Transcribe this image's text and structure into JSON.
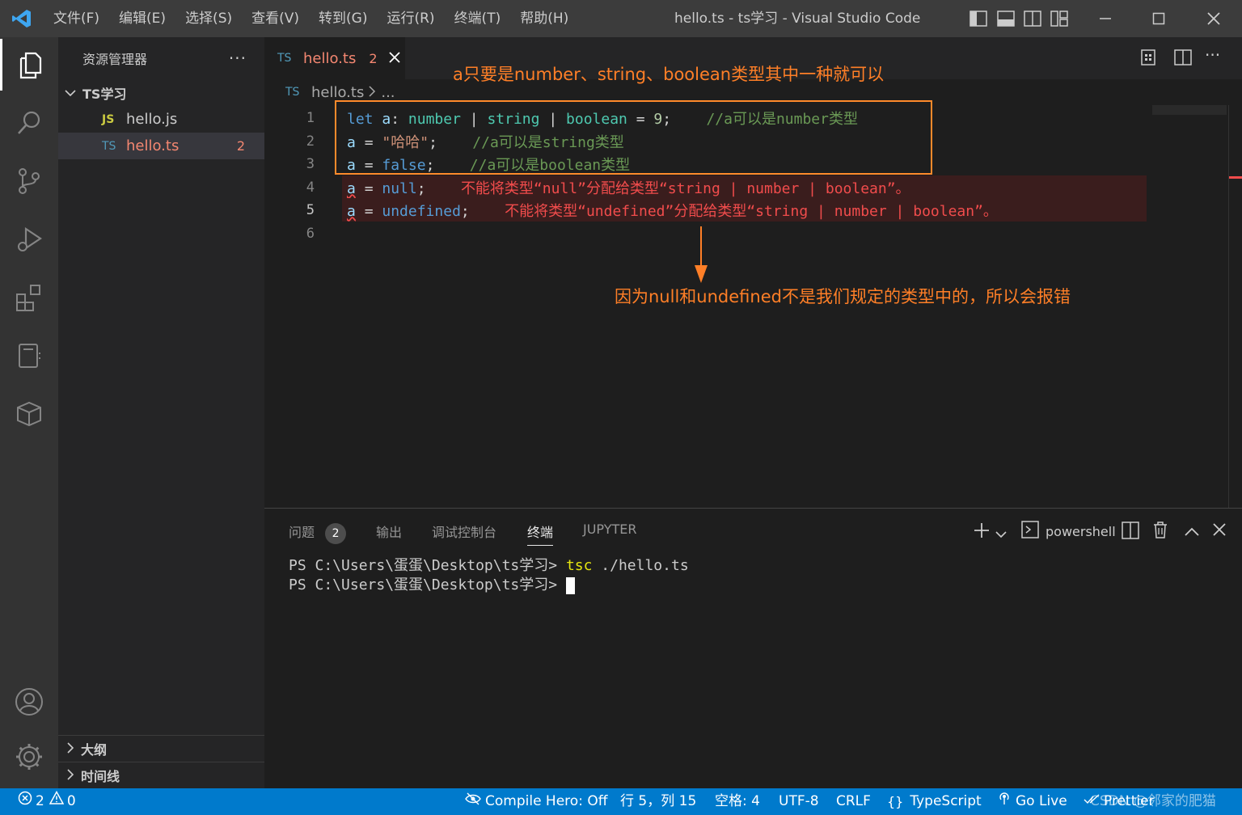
{
  "titlebar": {
    "menus": [
      "文件(F)",
      "编辑(E)",
      "选择(S)",
      "查看(V)",
      "转到(G)",
      "运行(R)",
      "终端(T)",
      "帮助(H)"
    ],
    "window_title": "hello.ts - ts学习 - Visual Studio Code"
  },
  "sidebar": {
    "title": "资源管理器",
    "folder": "TS学习",
    "files": [
      {
        "badge": "JS",
        "name": "hello.js",
        "problems": ""
      },
      {
        "badge": "TS",
        "name": "hello.ts",
        "problems": "2"
      }
    ],
    "outline": "大纲",
    "timeline": "时间线"
  },
  "tab": {
    "badge": "TS",
    "name": "hello.ts",
    "problems": "2"
  },
  "breadcrumb": {
    "badge": "TS",
    "file": "hello.ts",
    "rest": "..."
  },
  "editor": {
    "line_numbers": [
      "1",
      "2",
      "3",
      "4",
      "5",
      "6"
    ],
    "line1": {
      "kw": "let",
      "var": "a",
      "colon": ":",
      "t1": "number",
      "bar": "|",
      "t2": "string",
      "t3": "boolean",
      "eq": "=",
      "num": "9",
      "semi": ";",
      "comment": "//a可以是number类型"
    },
    "line2": {
      "var": "a",
      "eq": "=",
      "str": "\"哈哈\"",
      "semi": ";",
      "comment": "//a可以是string类型"
    },
    "line3": {
      "var": "a",
      "eq": "=",
      "val": "false",
      "semi": ";",
      "comment": "//a可以是boolean类型"
    },
    "line4": {
      "var": "a",
      "eq": "=",
      "val": "null",
      "semi": ";",
      "error": "不能将类型“null”分配给类型“string | number | boolean”。"
    },
    "line5": {
      "var": "a",
      "eq": "=",
      "val": "undefined",
      "semi": ";",
      "error": "不能将类型“undefined”分配给类型“string | number | boolean”。"
    }
  },
  "annotations": {
    "top": "a只要是number、string、boolean类型其中一种就可以",
    "bottom": "因为null和undefined不是我们规定的类型中的，所以会报错"
  },
  "panel": {
    "tabs": [
      "问题",
      "输出",
      "调试控制台",
      "终端",
      "JUPYTER"
    ],
    "problems_count": "2",
    "shell": "powershell",
    "terminal": {
      "prompt": "PS C:\\Users\\蛋蛋\\Desktop\\ts学习>",
      "cmd": "tsc",
      "args": " ./hello.ts"
    }
  },
  "statusbar": {
    "errors": "2",
    "warnings": "0",
    "compile_hero": "Compile Hero: Off",
    "position": "行 5，列 15",
    "spaces": "空格: 4",
    "encoding": "UTF-8",
    "eol": "CRLF",
    "language": "TypeScript",
    "golive": "Go Live",
    "prettier": "Prettier",
    "watermark": "CSDN @邻家的肥猫"
  },
  "colors": {
    "accent": "#007acc",
    "annotation": "#ff7f27",
    "error": "#f14c4c"
  }
}
